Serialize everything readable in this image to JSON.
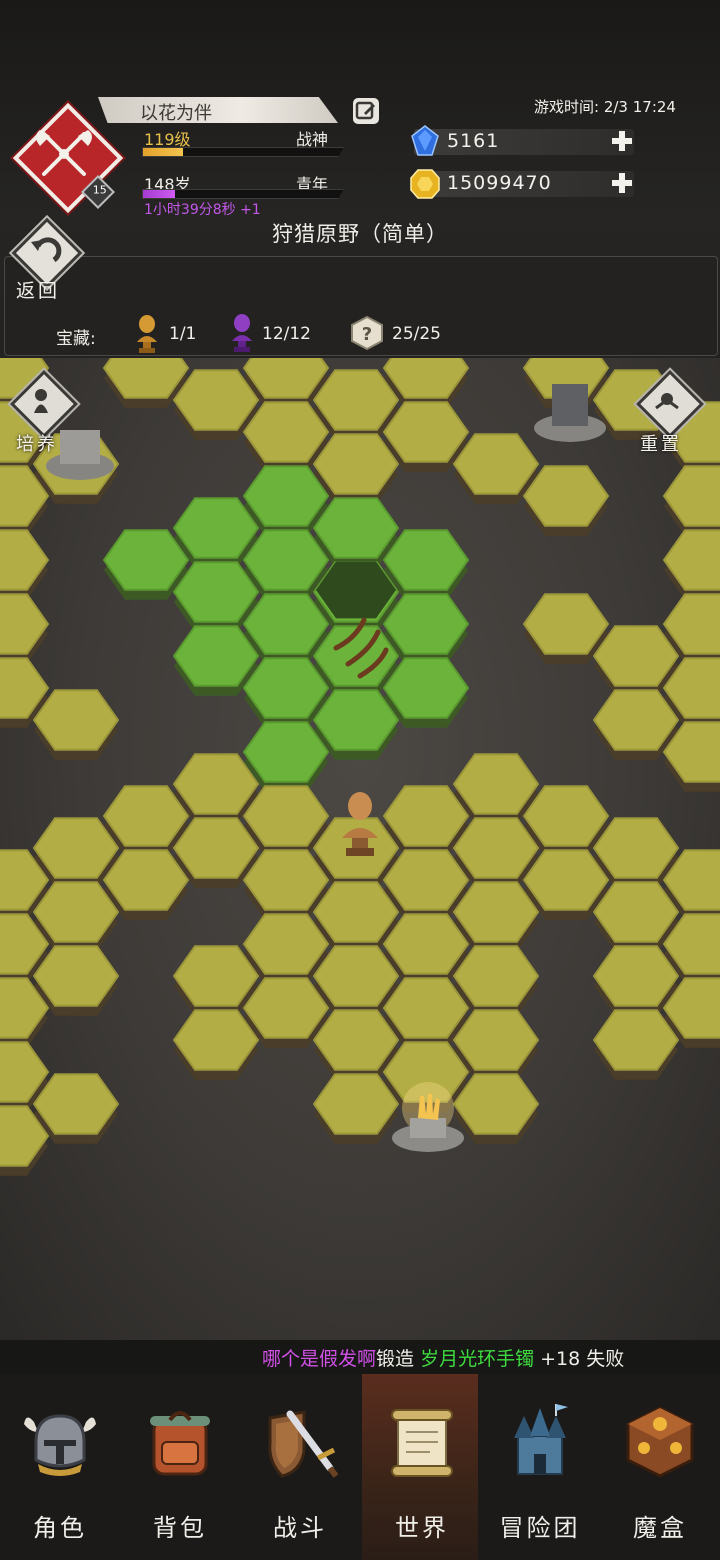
{
  "player": {
    "name": "以花为伴",
    "level_label": "119级",
    "level_progress": 0.2,
    "class_label": "战神",
    "age_label": "148岁",
    "life_stage": "青年",
    "age_progress": 0.16,
    "timer_text": "1小时39分8秒 +1",
    "badge_level": "15"
  },
  "header": {
    "game_time": "游戏时间: 2/3 17:24",
    "diamonds": "5161",
    "gold": "15099470",
    "map_title": "狩猎原野（简单）",
    "back_label": "返回"
  },
  "treasure": {
    "label": "宝藏:",
    "items": [
      {
        "icon": "golden-bust-icon",
        "count": "1/1"
      },
      {
        "icon": "purple-bust-icon",
        "count": "12/12"
      },
      {
        "icon": "question-tile-icon",
        "count": "25/25"
      }
    ]
  },
  "map_buttons": {
    "train_label": "培养",
    "reset_label": "重置"
  },
  "ticker": {
    "player": "哪个是假发啊",
    "action": "锻造",
    "item": "岁月光环手镯",
    "result": "+18 失败"
  },
  "nav": [
    {
      "label": "角色",
      "icon": "helmet-icon"
    },
    {
      "label": "背包",
      "icon": "backpack-icon"
    },
    {
      "label": "战斗",
      "icon": "sword-shield-icon"
    },
    {
      "label": "世界",
      "icon": "scroll-icon",
      "active": true
    },
    {
      "label": "冒险团",
      "icon": "castle-icon"
    },
    {
      "label": "魔盒",
      "icon": "magic-box-icon"
    }
  ],
  "colors": {
    "emblem_red": "#b8262a",
    "level_bar": "#f3c54f",
    "age_bar": "#cf5cf2",
    "tile_yellow": "#b3ad45",
    "tile_green": "#6bb33a",
    "ticker_player": "#d24fe8",
    "ticker_item": "#3fdc3f"
  }
}
